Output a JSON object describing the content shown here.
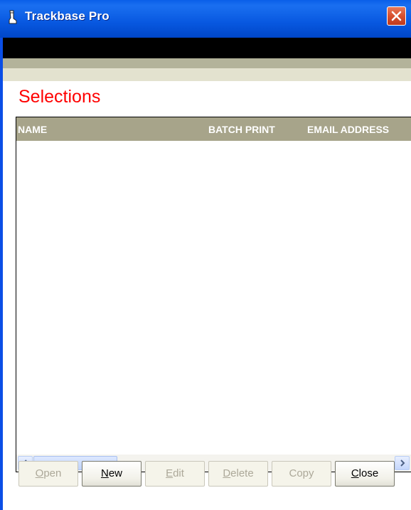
{
  "window": {
    "title": "Trackbase Pro"
  },
  "icons": {
    "app": "boot-icon",
    "close": "close-icon",
    "scroll_left": "arrow-left-icon",
    "scroll_right": "arrow-right-icon"
  },
  "colors": {
    "heading": "#ff0000",
    "grid_header_bg": "#a7a48a",
    "titlebar": "#0a4ee6"
  },
  "main": {
    "heading": "Selections",
    "grid": {
      "columns": [
        "NAME",
        "BATCH PRINT",
        "EMAIL ADDRESS"
      ],
      "rows": []
    }
  },
  "buttons": [
    {
      "accel": "O",
      "rest": "pen",
      "enabled": false
    },
    {
      "accel": "N",
      "rest": "ew",
      "enabled": true
    },
    {
      "accel": "E",
      "rest": "dit",
      "enabled": false
    },
    {
      "accel": "D",
      "rest": "elete",
      "enabled": false
    },
    {
      "accel": "",
      "rest": "Copy",
      "enabled": false
    },
    {
      "accel": "C",
      "rest": "lose",
      "enabled": true
    }
  ]
}
